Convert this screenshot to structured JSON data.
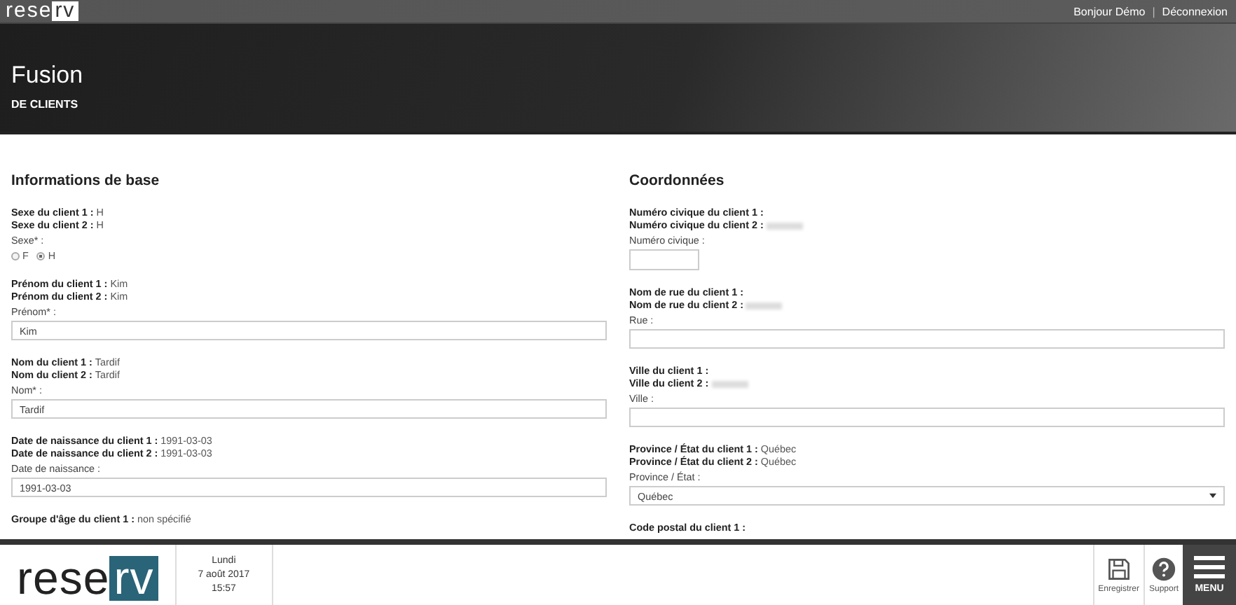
{
  "topbar": {
    "logo": {
      "left": "rese",
      "right": "rv"
    },
    "greeting": "Bonjour Démo",
    "separator": "|",
    "logout": "Déconnexion"
  },
  "header": {
    "title": "Fusion",
    "subtitle": "DE CLIENTS"
  },
  "columns": [
    {
      "title": "Informations de base",
      "groups": [
        {
          "comparisons": [
            {
              "label": "Sexe du client 1 :",
              "value": "H"
            },
            {
              "label": "Sexe du client 2 :",
              "value": "H"
            }
          ],
          "field": {
            "kind": "radio",
            "label": "Sexe* :",
            "options": [
              {
                "label": "F",
                "selected": false
              },
              {
                "label": "H",
                "selected": true
              }
            ]
          }
        },
        {
          "comparisons": [
            {
              "label": "Prénom du client 1 :",
              "value": "Kim"
            },
            {
              "label": "Prénom du client 2 :",
              "value": "Kim"
            }
          ],
          "field": {
            "kind": "text",
            "label": "Prénom* :",
            "value": "Kim"
          }
        },
        {
          "comparisons": [
            {
              "label": "Nom du client 1 :",
              "value": "Tardif"
            },
            {
              "label": "Nom du client 2 :",
              "value": "Tardif"
            }
          ],
          "field": {
            "kind": "text",
            "label": "Nom* :",
            "value": "Tardif"
          }
        },
        {
          "comparisons": [
            {
              "label": "Date de naissance du client 1 :",
              "value": "1991-03-03"
            },
            {
              "label": "Date de naissance du client 2 :",
              "value": "1991-03-03"
            }
          ],
          "field": {
            "kind": "text",
            "label": "Date de naissance :",
            "value": "1991-03-03"
          }
        },
        {
          "comparisons": [
            {
              "label": "Groupe d'âge du client 1 :",
              "value": "non spécifié"
            }
          ]
        }
      ]
    },
    {
      "title": "Coordonnées",
      "groups": [
        {
          "comparisons": [
            {
              "label": "Numéro civique du client 1 :"
            },
            {
              "label": "Numéro civique du client 2 :",
              "redacted": true
            }
          ],
          "field": {
            "kind": "short",
            "label": "Numéro civique :"
          }
        },
        {
          "comparisons": [
            {
              "label": "Nom de rue du client 1 :"
            },
            {
              "label": "Nom de rue du client 2 :",
              "redacted": true
            }
          ],
          "field": {
            "kind": "text",
            "label": "Rue :"
          }
        },
        {
          "comparisons": [
            {
              "label": "Ville du client 1 :"
            },
            {
              "label": "Ville du client 2 :",
              "redacted": true
            }
          ],
          "field": {
            "kind": "text",
            "label": "Ville :"
          }
        },
        {
          "comparisons": [
            {
              "label": "Province / État du client 1 :",
              "value": "Québec"
            },
            {
              "label": "Province / État du client 2 :",
              "value": "Québec"
            }
          ],
          "field": {
            "kind": "select",
            "label": "Province / État :",
            "value": "Québec"
          }
        },
        {
          "comparisons": [
            {
              "label": "Code postal du client 1 :"
            }
          ]
        }
      ]
    }
  ],
  "footer": {
    "logo": {
      "left": "rese",
      "right": "rv"
    },
    "day": "Lundi",
    "date": "7 août 2017",
    "time": "15:57",
    "actions": [
      {
        "kind": "save",
        "label": "Enregistrer"
      },
      {
        "kind": "help",
        "label": "Support"
      }
    ],
    "menu": "MENU"
  }
}
